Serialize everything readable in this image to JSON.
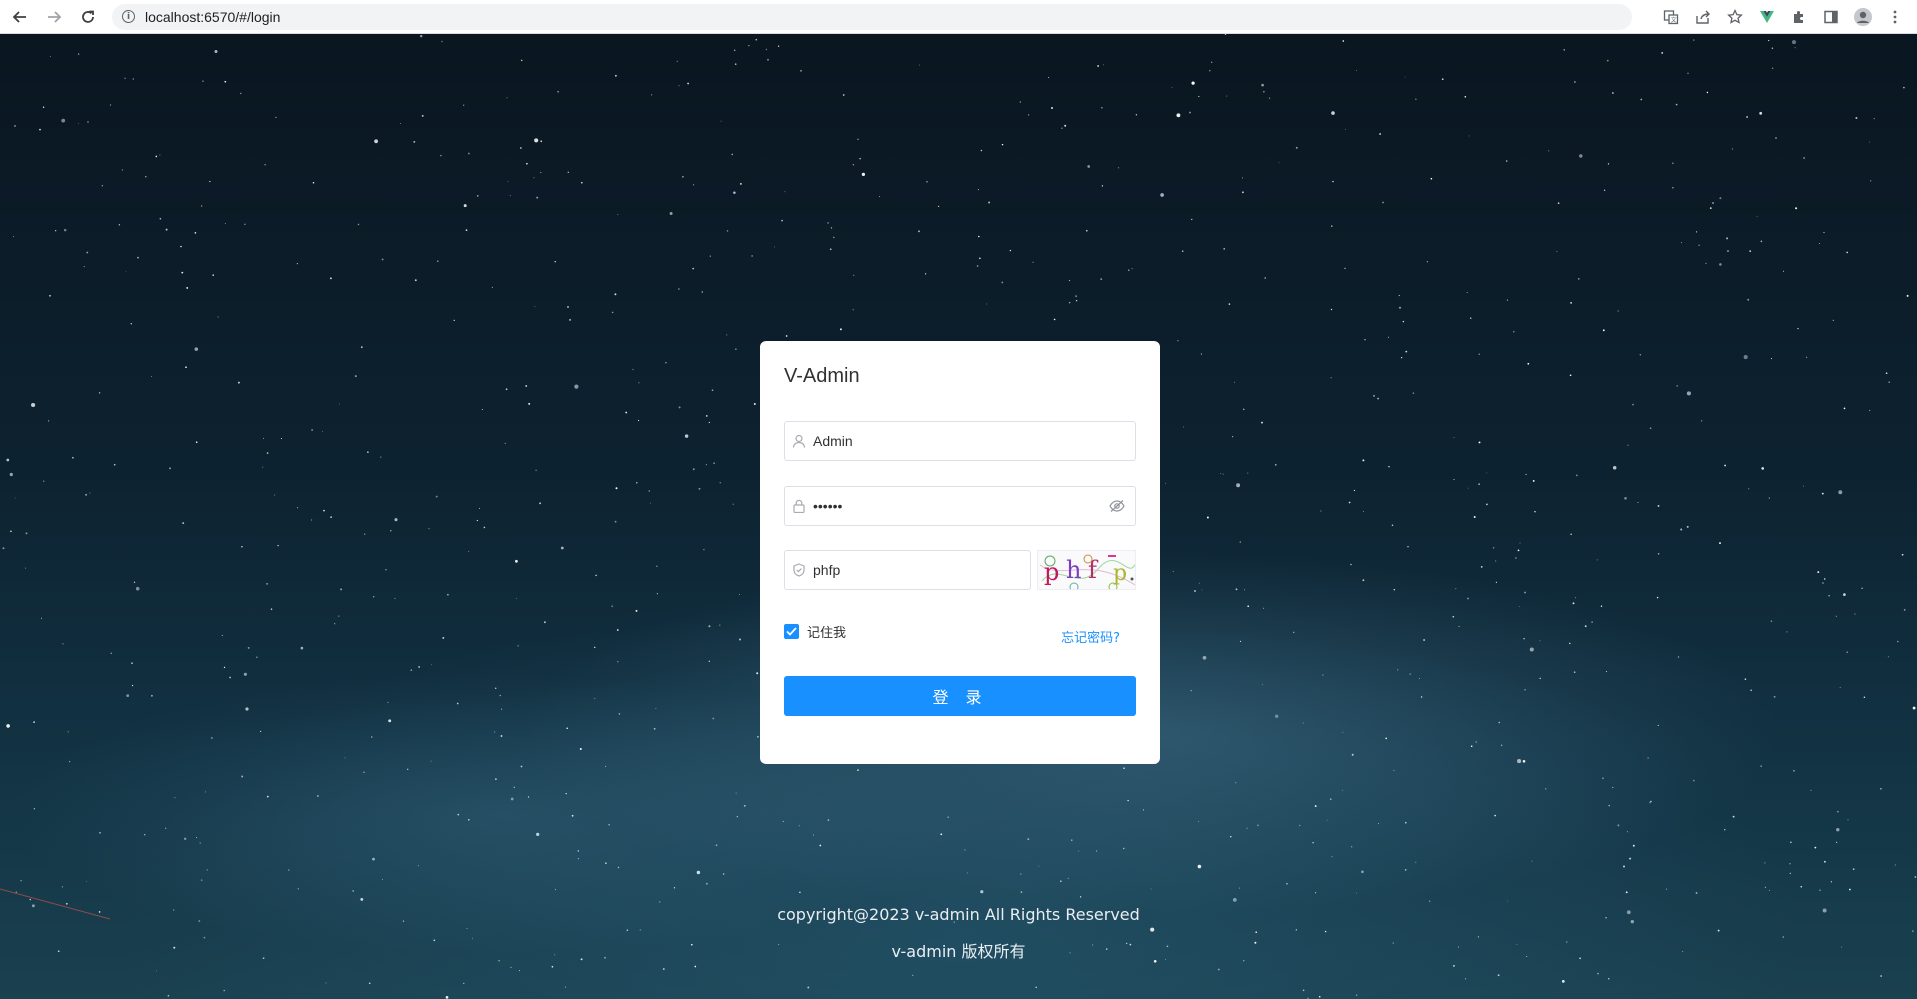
{
  "browser": {
    "url": "localhost:6570/#/login",
    "back_icon": "arrow-left-icon",
    "forward_icon": "arrow-right-icon",
    "reload_icon": "reload-icon"
  },
  "login": {
    "title": "V-Admin",
    "username_value": "Admin",
    "password_value": "••••••",
    "captcha_value": "phfp",
    "captcha_image_text": "phfp",
    "remember_label": "记住我",
    "remember_checked": true,
    "forgot_label": "忘记密码?",
    "submit_label": "登 录",
    "accent_color": "#1890ff"
  },
  "footer": {
    "copyright": "copyright@2023 v-admin All Rights Reserved",
    "rights": "v-admin 版权所有"
  }
}
